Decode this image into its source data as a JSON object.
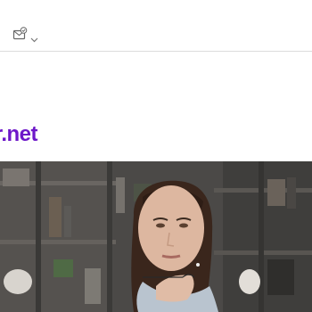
{
  "toolbar": {
    "mail_icon": "mail-check-icon",
    "dropdown_icon": "chevron-down-icon"
  },
  "brand": {
    "text_visible": "r.net",
    "color": "#6d17c9"
  },
  "hero": {
    "image_subject": "woman-thinking-photo"
  }
}
